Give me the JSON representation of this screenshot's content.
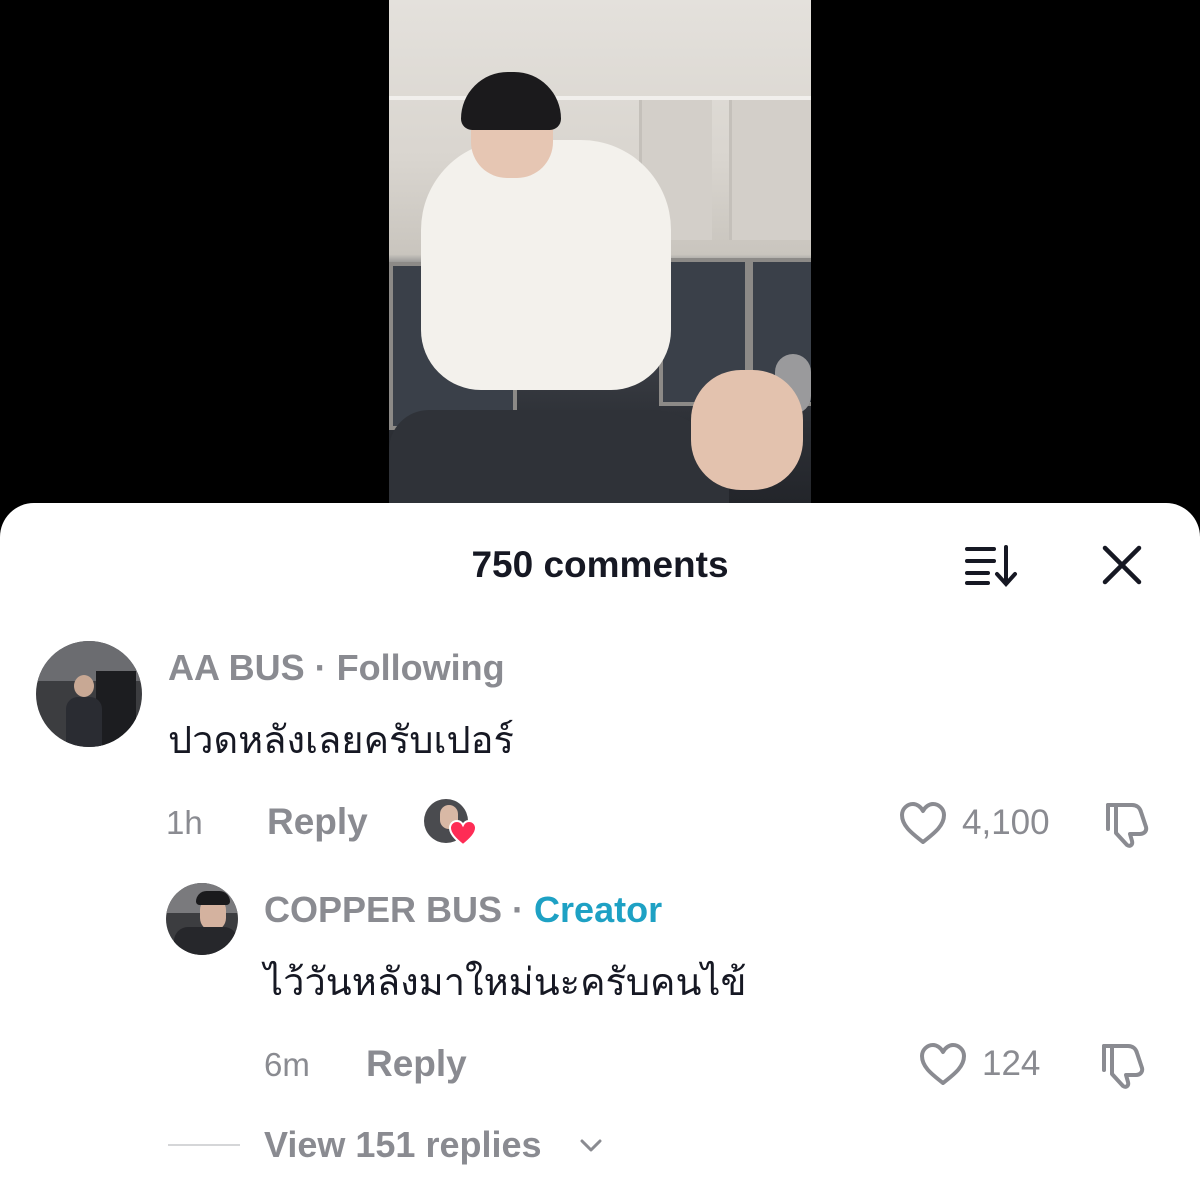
{
  "sheet": {
    "title": "750 comments"
  },
  "comments": [
    {
      "username": "AA BUS",
      "separator": "·",
      "tag": "Following",
      "text": "ปวดหลังเลยครับเปอร์",
      "time": "1h",
      "reply_label": "Reply",
      "likes": "4,100",
      "liked_by_creator": true
    },
    {
      "username": "COPPER BUS",
      "separator": "·",
      "tag": "Creator",
      "text": "ไว้วันหลังมาใหม่นะครับคนไข้",
      "time": "6m",
      "reply_label": "Reply",
      "likes": "124"
    }
  ],
  "view_replies": {
    "label": "View 151 replies"
  },
  "colors": {
    "creator_tag": "#1ea1c4",
    "muted_text": "#8a8b91",
    "heart_red": "#fe2c55"
  }
}
